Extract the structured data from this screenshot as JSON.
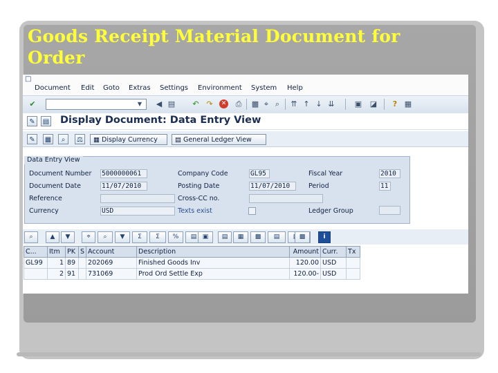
{
  "slide": {
    "title": "Goods Receipt Material Document for Order"
  },
  "menu": {
    "items": [
      "Document",
      "Edit",
      "Goto",
      "Extras",
      "Settings",
      "Environment",
      "System",
      "Help"
    ]
  },
  "screen": {
    "title": "Display Document: Data Entry View"
  },
  "app_toolbar": {
    "display_currency": "Display Currency",
    "general_ledger_view": "General Ledger View"
  },
  "header": {
    "section_title": "Data Entry View",
    "document_number_label": "Document Number",
    "document_number": "5000000061",
    "company_code_label": "Company Code",
    "company_code": "GL95",
    "fiscal_year_label": "Fiscal Year",
    "fiscal_year": "2010",
    "document_date_label": "Document Date",
    "document_date": "11/07/2010",
    "posting_date_label": "Posting Date",
    "posting_date": "11/07/2010",
    "period_label": "Period",
    "period": "11",
    "reference_label": "Reference",
    "reference": "",
    "cross_cc_label": "Cross-CC no.",
    "cross_cc": "",
    "currency_label": "Currency",
    "currency": "USD",
    "texts_exist_label": "Texts exist",
    "ledger_group_label": "Ledger Group",
    "ledger_group": ""
  },
  "grid": {
    "columns": [
      "C...",
      "Itm",
      "PK",
      "S",
      "Account",
      "Description",
      "Amount",
      "Curr.",
      "Tx"
    ],
    "rows": [
      [
        "GL99",
        "1",
        "89",
        "",
        "202069",
        "Finished Goods Inv",
        "120.00",
        "USD",
        ""
      ],
      [
        "",
        "2",
        "91",
        "",
        "731069",
        "Prod Ord Settle Exp",
        "120.00-",
        "USD",
        ""
      ]
    ]
  },
  "colors": {
    "title_yellow": "#ffff38",
    "sap_blue": "#d7e2ee",
    "slide_gray": "#a7a7a7"
  }
}
